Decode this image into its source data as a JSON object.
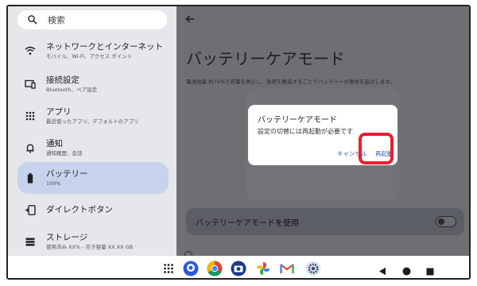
{
  "search": {
    "placeholder": "検索"
  },
  "sidebar": {
    "items": [
      {
        "title": "ネットワークとインターネット",
        "subtitle": "モバイル、Wi-Fi、アクセス ポイント",
        "icon": "wifi-icon"
      },
      {
        "title": "接続設定",
        "subtitle": "Bluetooth、ペア設定",
        "icon": "connected-devices-icon"
      },
      {
        "title": "アプリ",
        "subtitle": "最近使ったアプリ、デフォルトのアプリ",
        "icon": "apps-grid-icon"
      },
      {
        "title": "通知",
        "subtitle": "通知履歴、会話",
        "icon": "bell-icon"
      },
      {
        "title": "バッテリー",
        "subtitle": "100%",
        "icon": "battery-icon",
        "active": true
      },
      {
        "title": "ダイレクトボタン",
        "subtitle": "",
        "icon": "direct-button-icon"
      },
      {
        "title": "ストレージ",
        "subtitle": "使用済み XX% - 空き容量 XX.XX GB",
        "icon": "storage-icon"
      }
    ]
  },
  "main": {
    "title": "バッテリーケアモード",
    "description": "電池残量 約75%で充電を停止し、負荷を軽減することでバッテリーの寿命を延ばします。",
    "toggle_label": "バッテリーケアモードを使用"
  },
  "dialog": {
    "title": "バッテリーケアモード",
    "body": "設定の切替には再起動が必要です",
    "cancel": "キャンセル",
    "restart": "再起動"
  },
  "colors": {
    "accent": "#3a56a8",
    "highlight": "#ef1b2d",
    "active_item": "#c7d2ec"
  },
  "taskbar": {
    "apps": [
      "app-drawer-icon",
      "camera-app-icon",
      "chrome-icon",
      "camera-icon",
      "photos-icon",
      "gmail-icon",
      "settings-icon"
    ],
    "nav": [
      "back-icon",
      "home-icon",
      "recents-icon"
    ]
  }
}
